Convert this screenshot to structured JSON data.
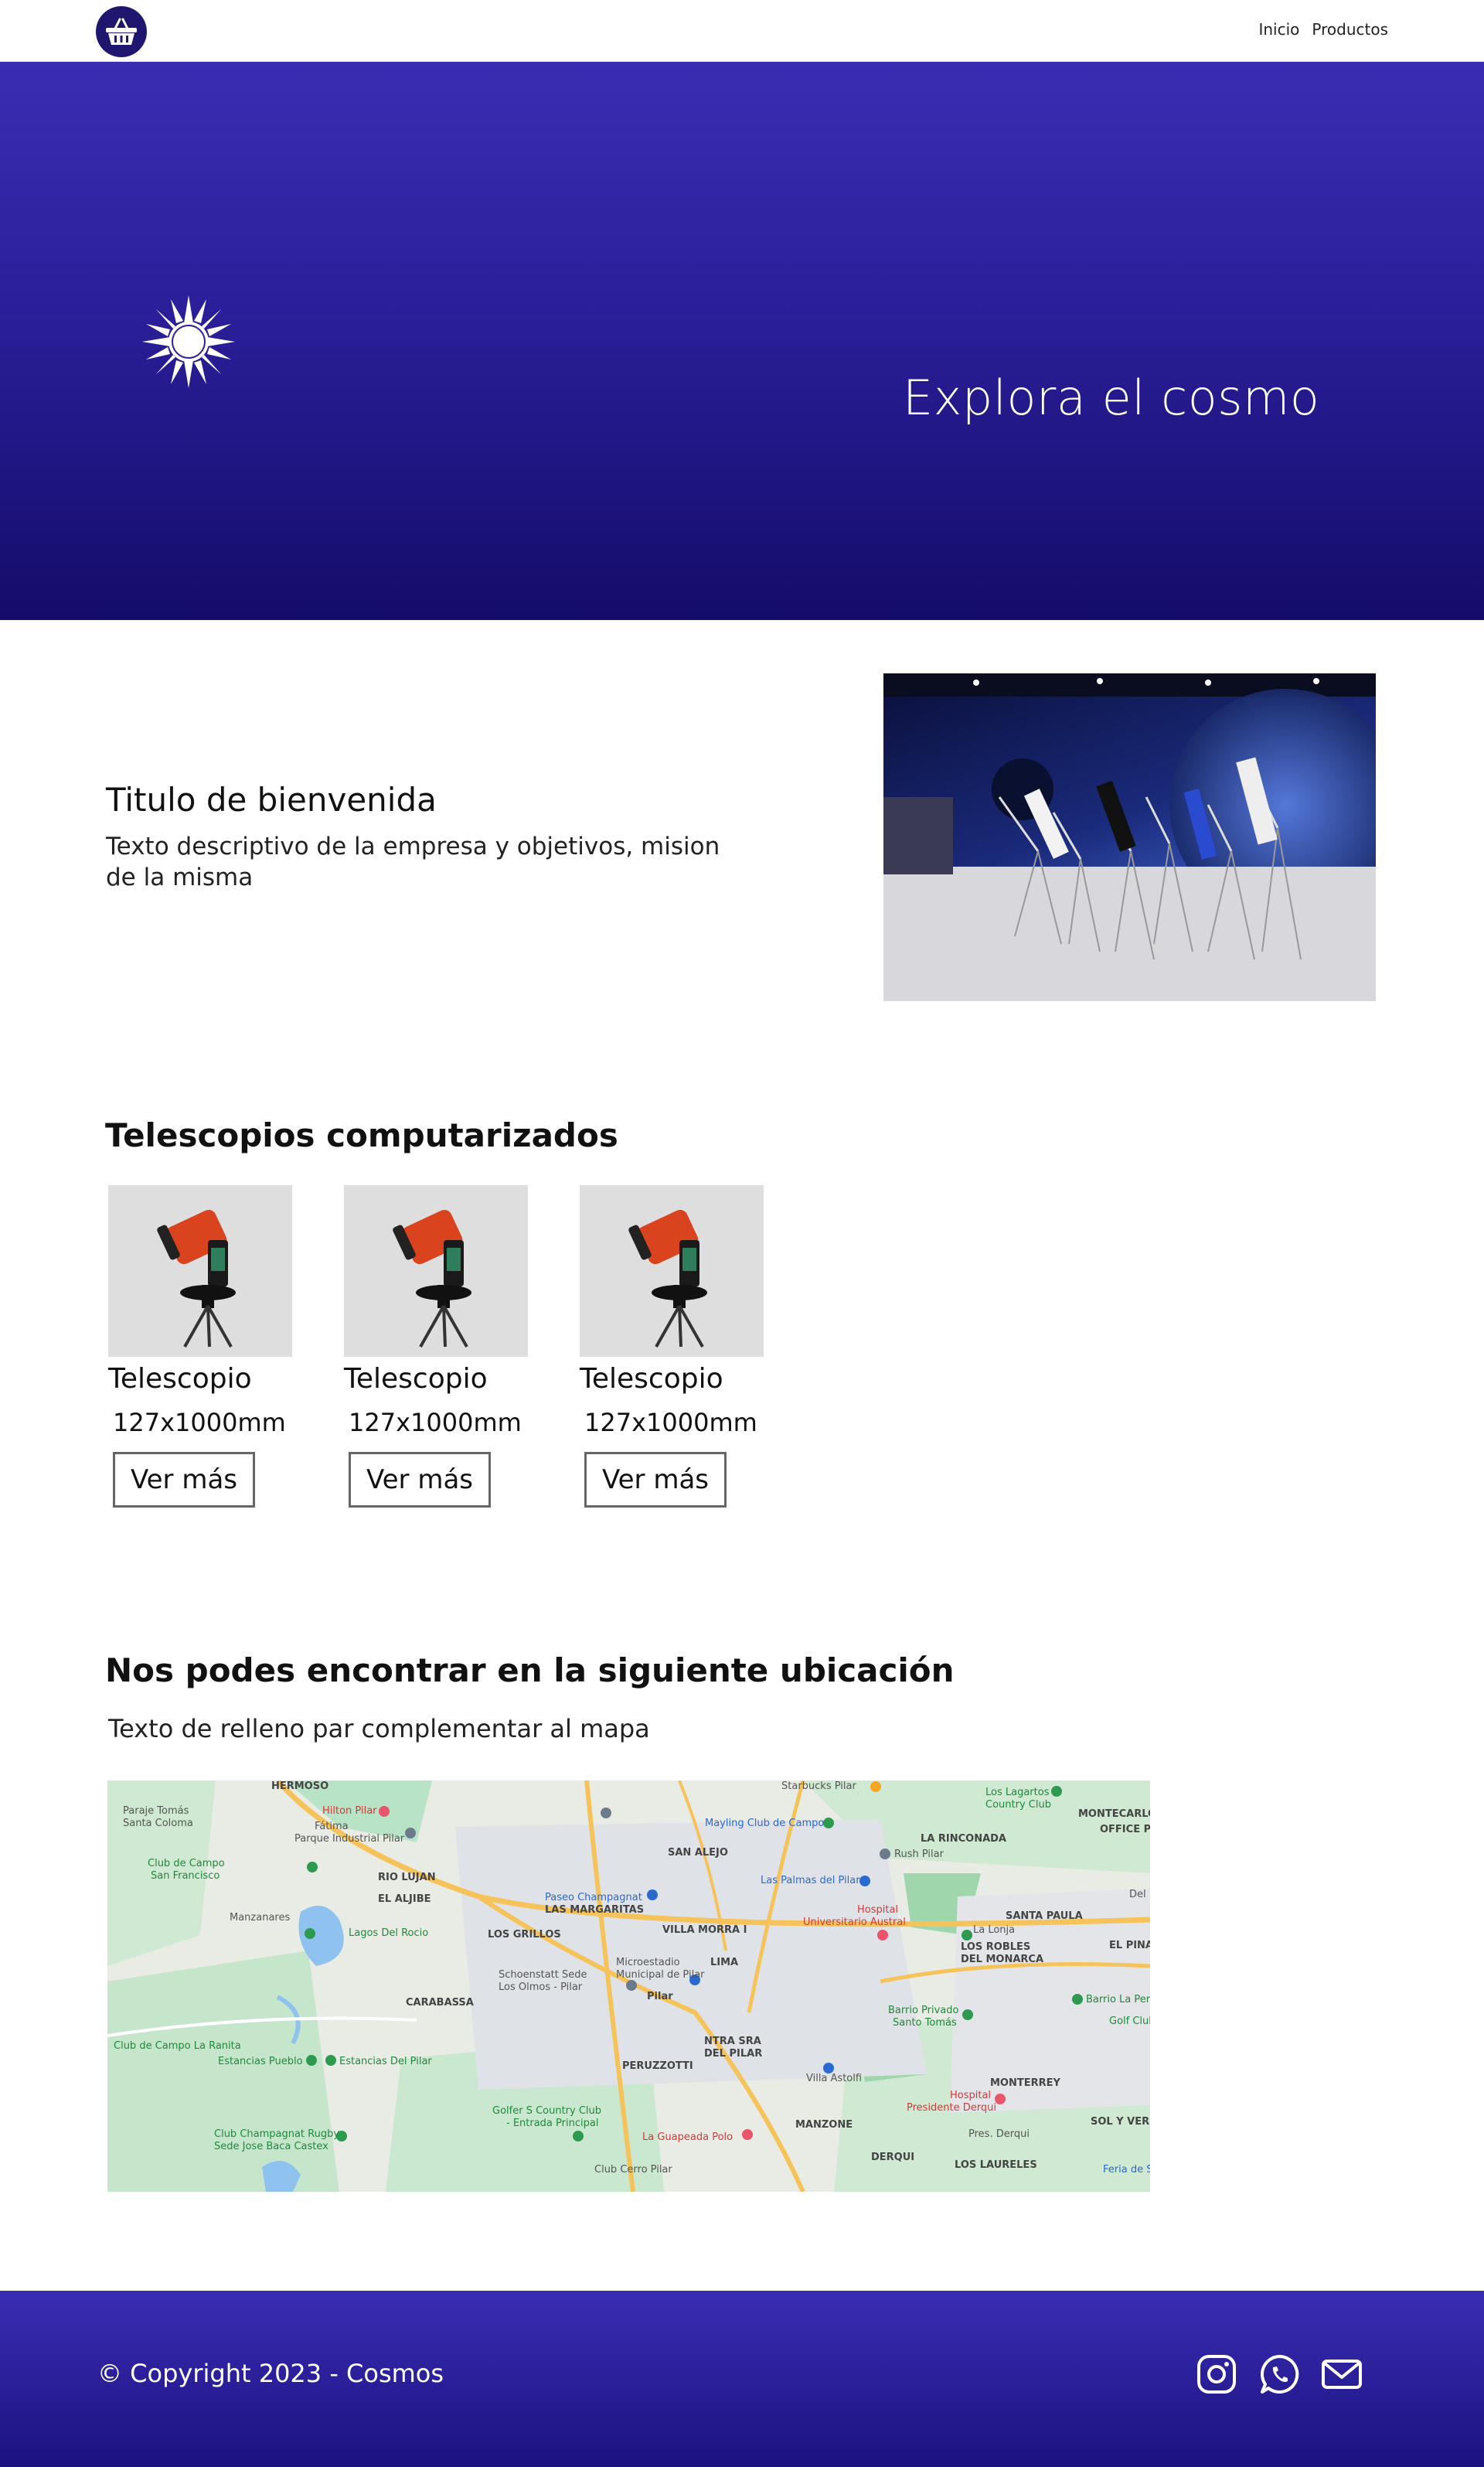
{
  "nav": {
    "logo_icon": "shopping-basket-icon",
    "links": [
      "Inicio",
      "Productos"
    ]
  },
  "hero": {
    "icon": "sun-icon",
    "title": "Explora el cosmo"
  },
  "welcome": {
    "title": "Titulo de bienvenida",
    "text": "Texto descriptivo de la empresa y objetivos, mision de la misma"
  },
  "products": {
    "title": "Telescopios computarizados",
    "items": [
      {
        "name": "Telescopio",
        "size": "127x1000mm",
        "button": "Ver más"
      },
      {
        "name": "Telescopio",
        "size": "127x1000mm",
        "button": "Ver más"
      },
      {
        "name": "Telescopio",
        "size": "127x1000mm",
        "button": "Ver más"
      }
    ]
  },
  "location": {
    "title": "Nos podes encontrar en la siguiente ubicación",
    "text": "Texto de relleno par complementar al mapa",
    "map_labels": {
      "hermoso": "HERMOSO",
      "paraje": "Paraje Tomás",
      "santa_coloma": "Santa Coloma",
      "hilton": "Hilton Pilar",
      "fatima": "Fátima",
      "parque_industrial": "Parque Industrial Pilar",
      "club_campo_sf": "Club de Campo",
      "san_francisco": "San Francisco",
      "rio_lujan": "RIO LUJAN",
      "el_aljibe": "EL ALJIBE",
      "manzanares": "Manzanares",
      "lagos_rocio": "Lagos Del Rocio",
      "mayling": "Mayling Club de Campo",
      "san_alejo": "SAN ALEJO",
      "paseo_champagnat": "Paseo Champagnat",
      "las_margaritas": "LAS MARGARITAS",
      "los_grillos": "LOS GRILLOS",
      "las_palmas": "Las Palmas del Pilar",
      "villa_morra": "VILLA MORRA I",
      "microestadio": "Microestadio",
      "municipal": "Municipal de Pilar",
      "lima": "LIMA",
      "schoenstatt": "Schoenstatt Sede",
      "los_olmos": "Los Olmos - Pilar",
      "pilar": "Pilar",
      "carabassa": "CARABASSA",
      "club_ranita": "Club de Campo La Ranita",
      "estancias_pueblo": "Estancias Pueblo",
      "estancias_pilar": "Estancias Del Pilar",
      "peruzzotti": "PERUZZOTTI",
      "ntra_sra": "NTRA SRA",
      "del_pilar": "DEL PILAR",
      "villa_astolfi": "Villa Astolfi",
      "golfers": "Golfer S Country Club",
      "entrada_principal": "- Entrada Principal",
      "champagnat_rugby": "Club Champagnat Rugby",
      "sede_baca": "Sede Jose Baca Castex",
      "la_guapeada": "La Guapeada Polo",
      "club_cerro": "Club Cerro Pilar",
      "manzone": "MANZONE",
      "los_lagartos": "Los Lagartos",
      "country_club": "Country Club",
      "montecarlo": "MONTECARLO",
      "office_park": "OFFICE PA",
      "la_rinconada": "LA RINCONADA",
      "rush_pilar": "Rush Pilar",
      "hospital_austral": "Hospital",
      "universitario_austral": "Universitario Austral",
      "la_lonja": "La Lonja",
      "santa_paula": "SANTA PAULA",
      "los_robles": "LOS ROBLES",
      "del_monarca": "DEL MONARCA",
      "el_pina": "EL PINA",
      "barrio_privado": "Barrio Privado",
      "santo_tomas": "Santo Tomás",
      "barrio_la_pera": "Barrio La Pera",
      "golf_club": "Golf Club",
      "monterrey": "MONTERREY",
      "hospital_derqui": "Hospital",
      "presidente_derqui": "Presidente Derqui",
      "sol_y_verde": "SOL Y VERD",
      "pres_derqui": "Pres. Derqui",
      "derqui": "DERQUI",
      "los_laureles": "LOS LAURELES",
      "feria": "Feria de S",
      "del": "Del",
      "starbucks": "Starbucks Pilar"
    }
  },
  "footer": {
    "copyright": "© Copyright 2023 - Cosmos",
    "social": [
      "instagram-icon",
      "whatsapp-icon",
      "mail-icon"
    ]
  },
  "colors": {
    "brand": "#2a1f99",
    "brand_dark": "#140c6a",
    "logo_bg": "#1f1670"
  }
}
